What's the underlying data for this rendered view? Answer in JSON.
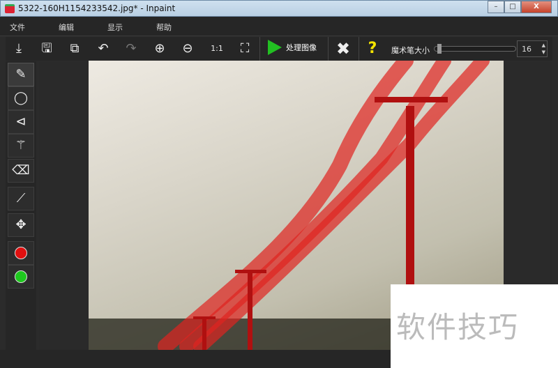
{
  "window": {
    "title": "5322-160H1154233542.jpg* - Inpaint",
    "minimize": "–",
    "maximize": "□",
    "close": "X"
  },
  "menu": [
    "文件",
    "编辑",
    "显示",
    "帮助"
  ],
  "toolbar": {
    "process_label": "处理图像",
    "brush_size_label": "魔术笔大小",
    "brush_size_value": "16",
    "brush_size_fraction": 0.02
  },
  "watermark": "软件技巧",
  "colors": {
    "mask": "#e0241f",
    "marker_red": "#e01010",
    "marker_green": "#1ec81e",
    "process": "#22c022",
    "help": "#f5e400"
  }
}
